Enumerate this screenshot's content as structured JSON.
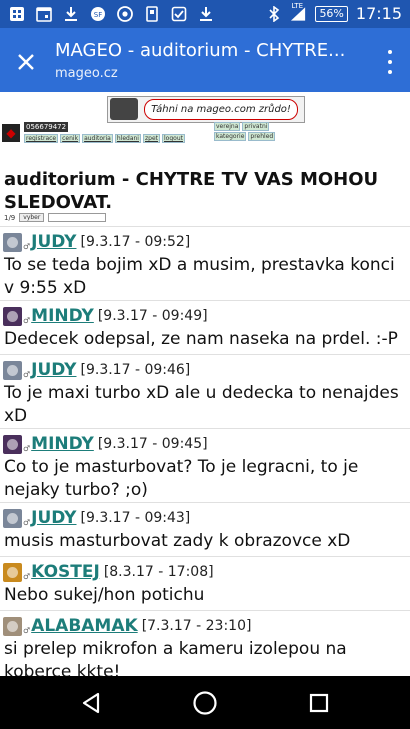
{
  "status_bar": {
    "network": "LTE",
    "battery": "56%",
    "time": "17:15"
  },
  "app_bar": {
    "title": "MAGEO - auditorium - CHYTRE...",
    "url": "mageo.cz"
  },
  "site": {
    "banner_text": "Táhni na mageo.com zrůdo!",
    "user_id": "056679472",
    "nav_links": [
      "registrace",
      "cenik",
      "auditoria",
      "hledani",
      "zpet",
      "logout"
    ],
    "nav_links2": [
      "verejna",
      "kategorie",
      "privatni",
      "prehled"
    ]
  },
  "topic": {
    "title": "auditorium - CHYTRE TV VAS MOHOU SLEDOVAT.",
    "page": "1/9",
    "select_label": "vyber"
  },
  "posts": [
    {
      "user": "JUDY",
      "time": "[9.3.17 - 09:52]",
      "text": "To se teda bojim xD a musim, prestavka konci v 9:55 xD",
      "avatar_color": "#7a8699"
    },
    {
      "user": "MINDY",
      "time": "[9.3.17 - 09:49]",
      "text": "Dedecek odepsal, ze nam naseka na prdel. :-P",
      "avatar_color": "#4a2f5c"
    },
    {
      "user": "JUDY",
      "time": "[9.3.17 - 09:46]",
      "text": "To je maxi turbo xD ale u dedecka to nenajdes xD",
      "avatar_color": "#7a8699"
    },
    {
      "user": "MINDY",
      "time": "[9.3.17 - 09:45]",
      "text": "Co to je masturbovat? To je legracni, to je nejaky turbo? ;o)",
      "avatar_color": "#4a2f5c"
    },
    {
      "user": "JUDY",
      "time": "[9.3.17 - 09:43]",
      "text": "musis masturbovat zady k obrazovce xD",
      "avatar_color": "#7a8699"
    },
    {
      "user": "KOSTEJ",
      "time": "[8.3.17 - 17:08]",
      "text": "Nebo sukej/hon potichu",
      "avatar_color": "#c98a1e"
    },
    {
      "user": "ALABAMAK",
      "time": "[7.3.17 - 23:10]",
      "text": "si prelep mikrofon a kameru izolepou na koberce kkte!",
      "avatar_color": "#a08f7a"
    }
  ]
}
